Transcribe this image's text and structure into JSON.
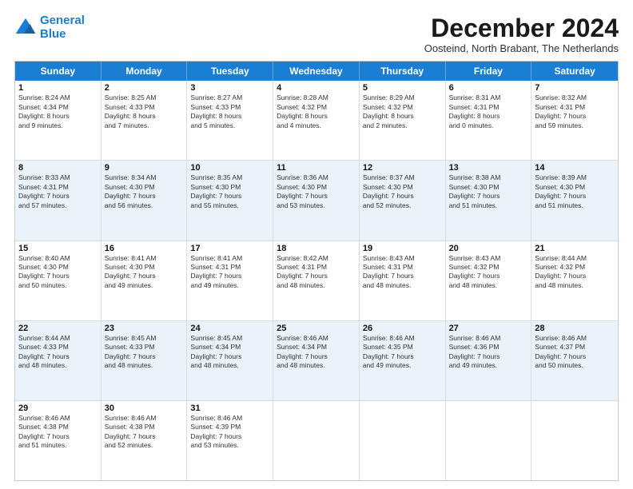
{
  "logo": {
    "line1": "General",
    "line2": "Blue"
  },
  "title": "December 2024",
  "subtitle": "Oosteind, North Brabant, The Netherlands",
  "days": [
    "Sunday",
    "Monday",
    "Tuesday",
    "Wednesday",
    "Thursday",
    "Friday",
    "Saturday"
  ],
  "weeks": [
    [
      {
        "day": 1,
        "lines": [
          "Sunrise: 8:24 AM",
          "Sunset: 4:34 PM",
          "Daylight: 8 hours",
          "and 9 minutes."
        ]
      },
      {
        "day": 2,
        "lines": [
          "Sunrise: 8:25 AM",
          "Sunset: 4:33 PM",
          "Daylight: 8 hours",
          "and 7 minutes."
        ]
      },
      {
        "day": 3,
        "lines": [
          "Sunrise: 8:27 AM",
          "Sunset: 4:33 PM",
          "Daylight: 8 hours",
          "and 5 minutes."
        ]
      },
      {
        "day": 4,
        "lines": [
          "Sunrise: 8:28 AM",
          "Sunset: 4:32 PM",
          "Daylight: 8 hours",
          "and 4 minutes."
        ]
      },
      {
        "day": 5,
        "lines": [
          "Sunrise: 8:29 AM",
          "Sunset: 4:32 PM",
          "Daylight: 8 hours",
          "and 2 minutes."
        ]
      },
      {
        "day": 6,
        "lines": [
          "Sunrise: 8:31 AM",
          "Sunset: 4:31 PM",
          "Daylight: 8 hours",
          "and 0 minutes."
        ]
      },
      {
        "day": 7,
        "lines": [
          "Sunrise: 8:32 AM",
          "Sunset: 4:31 PM",
          "Daylight: 7 hours",
          "and 59 minutes."
        ]
      }
    ],
    [
      {
        "day": 8,
        "lines": [
          "Sunrise: 8:33 AM",
          "Sunset: 4:31 PM",
          "Daylight: 7 hours",
          "and 57 minutes."
        ]
      },
      {
        "day": 9,
        "lines": [
          "Sunrise: 8:34 AM",
          "Sunset: 4:30 PM",
          "Daylight: 7 hours",
          "and 56 minutes."
        ]
      },
      {
        "day": 10,
        "lines": [
          "Sunrise: 8:35 AM",
          "Sunset: 4:30 PM",
          "Daylight: 7 hours",
          "and 55 minutes."
        ]
      },
      {
        "day": 11,
        "lines": [
          "Sunrise: 8:36 AM",
          "Sunset: 4:30 PM",
          "Daylight: 7 hours",
          "and 53 minutes."
        ]
      },
      {
        "day": 12,
        "lines": [
          "Sunrise: 8:37 AM",
          "Sunset: 4:30 PM",
          "Daylight: 7 hours",
          "and 52 minutes."
        ]
      },
      {
        "day": 13,
        "lines": [
          "Sunrise: 8:38 AM",
          "Sunset: 4:30 PM",
          "Daylight: 7 hours",
          "and 51 minutes."
        ]
      },
      {
        "day": 14,
        "lines": [
          "Sunrise: 8:39 AM",
          "Sunset: 4:30 PM",
          "Daylight: 7 hours",
          "and 51 minutes."
        ]
      }
    ],
    [
      {
        "day": 15,
        "lines": [
          "Sunrise: 8:40 AM",
          "Sunset: 4:30 PM",
          "Daylight: 7 hours",
          "and 50 minutes."
        ]
      },
      {
        "day": 16,
        "lines": [
          "Sunrise: 8:41 AM",
          "Sunset: 4:30 PM",
          "Daylight: 7 hours",
          "and 49 minutes."
        ]
      },
      {
        "day": 17,
        "lines": [
          "Sunrise: 8:41 AM",
          "Sunset: 4:31 PM",
          "Daylight: 7 hours",
          "and 49 minutes."
        ]
      },
      {
        "day": 18,
        "lines": [
          "Sunrise: 8:42 AM",
          "Sunset: 4:31 PM",
          "Daylight: 7 hours",
          "and 48 minutes."
        ]
      },
      {
        "day": 19,
        "lines": [
          "Sunrise: 8:43 AM",
          "Sunset: 4:31 PM",
          "Daylight: 7 hours",
          "and 48 minutes."
        ]
      },
      {
        "day": 20,
        "lines": [
          "Sunrise: 8:43 AM",
          "Sunset: 4:32 PM",
          "Daylight: 7 hours",
          "and 48 minutes."
        ]
      },
      {
        "day": 21,
        "lines": [
          "Sunrise: 8:44 AM",
          "Sunset: 4:32 PM",
          "Daylight: 7 hours",
          "and 48 minutes."
        ]
      }
    ],
    [
      {
        "day": 22,
        "lines": [
          "Sunrise: 8:44 AM",
          "Sunset: 4:33 PM",
          "Daylight: 7 hours",
          "and 48 minutes."
        ]
      },
      {
        "day": 23,
        "lines": [
          "Sunrise: 8:45 AM",
          "Sunset: 4:33 PM",
          "Daylight: 7 hours",
          "and 48 minutes."
        ]
      },
      {
        "day": 24,
        "lines": [
          "Sunrise: 8:45 AM",
          "Sunset: 4:34 PM",
          "Daylight: 7 hours",
          "and 48 minutes."
        ]
      },
      {
        "day": 25,
        "lines": [
          "Sunrise: 8:46 AM",
          "Sunset: 4:34 PM",
          "Daylight: 7 hours",
          "and 48 minutes."
        ]
      },
      {
        "day": 26,
        "lines": [
          "Sunrise: 8:46 AM",
          "Sunset: 4:35 PM",
          "Daylight: 7 hours",
          "and 49 minutes."
        ]
      },
      {
        "day": 27,
        "lines": [
          "Sunrise: 8:46 AM",
          "Sunset: 4:36 PM",
          "Daylight: 7 hours",
          "and 49 minutes."
        ]
      },
      {
        "day": 28,
        "lines": [
          "Sunrise: 8:46 AM",
          "Sunset: 4:37 PM",
          "Daylight: 7 hours",
          "and 50 minutes."
        ]
      }
    ],
    [
      {
        "day": 29,
        "lines": [
          "Sunrise: 8:46 AM",
          "Sunset: 4:38 PM",
          "Daylight: 7 hours",
          "and 51 minutes."
        ]
      },
      {
        "day": 30,
        "lines": [
          "Sunrise: 8:46 AM",
          "Sunset: 4:38 PM",
          "Daylight: 7 hours",
          "and 52 minutes."
        ]
      },
      {
        "day": 31,
        "lines": [
          "Sunrise: 8:46 AM",
          "Sunset: 4:39 PM",
          "Daylight: 7 hours",
          "and 53 minutes."
        ]
      },
      null,
      null,
      null,
      null
    ]
  ]
}
